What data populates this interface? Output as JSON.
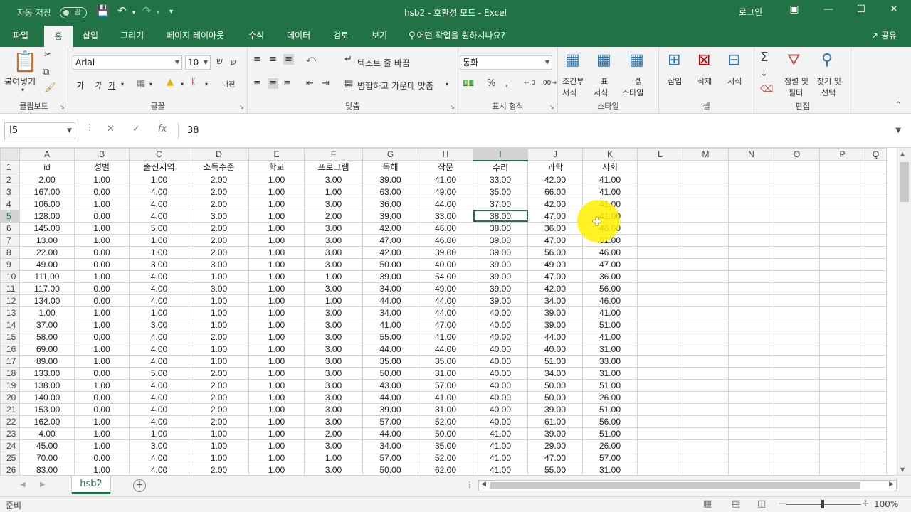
{
  "titlebar": {
    "autosave_label": "자동 저장",
    "autosave_state": "끔",
    "title": "hsb2  -  호환성 모드  -  Excel",
    "login": "로그인"
  },
  "tabs": [
    {
      "label": "파일"
    },
    {
      "label": "홈"
    },
    {
      "label": "삽입"
    },
    {
      "label": "그리기"
    },
    {
      "label": "페이지 레이아웃"
    },
    {
      "label": "수식"
    },
    {
      "label": "데이터"
    },
    {
      "label": "검토"
    },
    {
      "label": "보기"
    },
    {
      "label": "어떤 작업을 원하시나요?"
    }
  ],
  "share_label": "공유",
  "ribbon": {
    "clipboard": {
      "paste": "붙여넣기",
      "group": "클립보드"
    },
    "font": {
      "name": "Arial",
      "size": "10",
      "bold": "가",
      "italic": "가",
      "underline": "가",
      "phonetic": "내천",
      "group": "글꼴"
    },
    "align": {
      "wrap": "텍스트 줄 바꿈",
      "merge": "병합하고 가운데 맞춤",
      "group": "맞춤"
    },
    "number": {
      "format": "통화",
      "group": "표시 형식"
    },
    "styles": {
      "cond1": "조건부",
      "cond2": "서식",
      "table1": "표",
      "table2": "서식",
      "cell1": "셀",
      "cell2": "스타일",
      "group": "스타일"
    },
    "cells": {
      "insert": "삽입",
      "delete": "삭제",
      "format": "서식",
      "group": "셀"
    },
    "editing": {
      "sort1": "정렬 및",
      "sort2": "필터",
      "find1": "찾기 및",
      "find2": "선택",
      "group": "편집"
    }
  },
  "formula_bar": {
    "name_box": "I5",
    "value": "38"
  },
  "columns": [
    "A",
    "B",
    "C",
    "D",
    "E",
    "F",
    "G",
    "H",
    "I",
    "J",
    "K",
    "L",
    "M",
    "N",
    "O",
    "P",
    "Q"
  ],
  "rows": [
    {
      "n": "1",
      "cells": [
        "id",
        "성별",
        "출신지역",
        "소득수준",
        "학교",
        "프로그램",
        "독해",
        "작문",
        "수리",
        "과학",
        "사회"
      ]
    },
    {
      "n": "2",
      "cells": [
        "2.00",
        "1.00",
        "1.00",
        "2.00",
        "1.00",
        "3.00",
        "39.00",
        "41.00",
        "33.00",
        "42.00",
        "41.00"
      ]
    },
    {
      "n": "3",
      "cells": [
        "167.00",
        "0.00",
        "4.00",
        "2.00",
        "1.00",
        "1.00",
        "63.00",
        "49.00",
        "35.00",
        "66.00",
        "41.00"
      ]
    },
    {
      "n": "4",
      "cells": [
        "106.00",
        "1.00",
        "4.00",
        "2.00",
        "1.00",
        "3.00",
        "36.00",
        "44.00",
        "37.00",
        "42.00",
        "41.00"
      ]
    },
    {
      "n": "5",
      "cells": [
        "128.00",
        "0.00",
        "4.00",
        "3.00",
        "1.00",
        "2.00",
        "39.00",
        "33.00",
        "38.00",
        "47.00",
        "41.00"
      ]
    },
    {
      "n": "6",
      "cells": [
        "145.00",
        "1.00",
        "5.00",
        "2.00",
        "1.00",
        "3.00",
        "42.00",
        "46.00",
        "38.00",
        "36.00",
        "46.00"
      ]
    },
    {
      "n": "7",
      "cells": [
        "13.00",
        "1.00",
        "1.00",
        "2.00",
        "1.00",
        "3.00",
        "47.00",
        "46.00",
        "39.00",
        "47.00",
        "61.00"
      ]
    },
    {
      "n": "8",
      "cells": [
        "22.00",
        "0.00",
        "1.00",
        "2.00",
        "1.00",
        "3.00",
        "42.00",
        "39.00",
        "39.00",
        "56.00",
        "46.00"
      ]
    },
    {
      "n": "9",
      "cells": [
        "49.00",
        "0.00",
        "3.00",
        "3.00",
        "1.00",
        "3.00",
        "50.00",
        "40.00",
        "39.00",
        "49.00",
        "47.00"
      ]
    },
    {
      "n": "10",
      "cells": [
        "111.00",
        "1.00",
        "4.00",
        "1.00",
        "1.00",
        "1.00",
        "39.00",
        "54.00",
        "39.00",
        "47.00",
        "36.00"
      ]
    },
    {
      "n": "11",
      "cells": [
        "117.00",
        "0.00",
        "4.00",
        "3.00",
        "1.00",
        "3.00",
        "34.00",
        "49.00",
        "39.00",
        "42.00",
        "56.00"
      ]
    },
    {
      "n": "12",
      "cells": [
        "134.00",
        "0.00",
        "4.00",
        "1.00",
        "1.00",
        "1.00",
        "44.00",
        "44.00",
        "39.00",
        "34.00",
        "46.00"
      ]
    },
    {
      "n": "13",
      "cells": [
        "1.00",
        "1.00",
        "1.00",
        "1.00",
        "1.00",
        "3.00",
        "34.00",
        "44.00",
        "40.00",
        "39.00",
        "41.00"
      ]
    },
    {
      "n": "14",
      "cells": [
        "37.00",
        "1.00",
        "3.00",
        "1.00",
        "1.00",
        "3.00",
        "41.00",
        "47.00",
        "40.00",
        "39.00",
        "51.00"
      ]
    },
    {
      "n": "15",
      "cells": [
        "58.00",
        "0.00",
        "4.00",
        "2.00",
        "1.00",
        "3.00",
        "55.00",
        "41.00",
        "40.00",
        "44.00",
        "41.00"
      ]
    },
    {
      "n": "16",
      "cells": [
        "69.00",
        "1.00",
        "4.00",
        "1.00",
        "1.00",
        "3.00",
        "44.00",
        "44.00",
        "40.00",
        "40.00",
        "31.00"
      ]
    },
    {
      "n": "17",
      "cells": [
        "89.00",
        "1.00",
        "4.00",
        "1.00",
        "1.00",
        "3.00",
        "35.00",
        "35.00",
        "40.00",
        "51.00",
        "33.00"
      ]
    },
    {
      "n": "18",
      "cells": [
        "133.00",
        "0.00",
        "5.00",
        "2.00",
        "1.00",
        "3.00",
        "50.00",
        "31.00",
        "40.00",
        "34.00",
        "31.00"
      ]
    },
    {
      "n": "19",
      "cells": [
        "138.00",
        "1.00",
        "4.00",
        "2.00",
        "1.00",
        "3.00",
        "43.00",
        "57.00",
        "40.00",
        "50.00",
        "51.00"
      ]
    },
    {
      "n": "20",
      "cells": [
        "140.00",
        "0.00",
        "4.00",
        "2.00",
        "1.00",
        "3.00",
        "44.00",
        "41.00",
        "40.00",
        "50.00",
        "26.00"
      ]
    },
    {
      "n": "21",
      "cells": [
        "153.00",
        "0.00",
        "4.00",
        "2.00",
        "1.00",
        "3.00",
        "39.00",
        "31.00",
        "40.00",
        "39.00",
        "51.00"
      ]
    },
    {
      "n": "22",
      "cells": [
        "162.00",
        "1.00",
        "4.00",
        "2.00",
        "1.00",
        "3.00",
        "57.00",
        "52.00",
        "40.00",
        "61.00",
        "56.00"
      ]
    },
    {
      "n": "23",
      "cells": [
        "4.00",
        "1.00",
        "1.00",
        "1.00",
        "1.00",
        "2.00",
        "44.00",
        "50.00",
        "41.00",
        "39.00",
        "51.00"
      ]
    },
    {
      "n": "24",
      "cells": [
        "45.00",
        "1.00",
        "3.00",
        "1.00",
        "1.00",
        "3.00",
        "34.00",
        "35.00",
        "41.00",
        "29.00",
        "26.00"
      ]
    },
    {
      "n": "25",
      "cells": [
        "70.00",
        "0.00",
        "4.00",
        "1.00",
        "1.00",
        "1.00",
        "57.00",
        "52.00",
        "41.00",
        "47.00",
        "57.00"
      ]
    },
    {
      "n": "26",
      "cells": [
        "83.00",
        "1.00",
        "4.00",
        "2.00",
        "1.00",
        "3.00",
        "50.00",
        "62.00",
        "41.00",
        "55.00",
        "31.00"
      ]
    }
  ],
  "sheet_tab": "hsb2",
  "status": {
    "ready": "준비",
    "zoom": "100%"
  },
  "colors": {
    "accent": "#217346",
    "highlight": "#fff000"
  }
}
